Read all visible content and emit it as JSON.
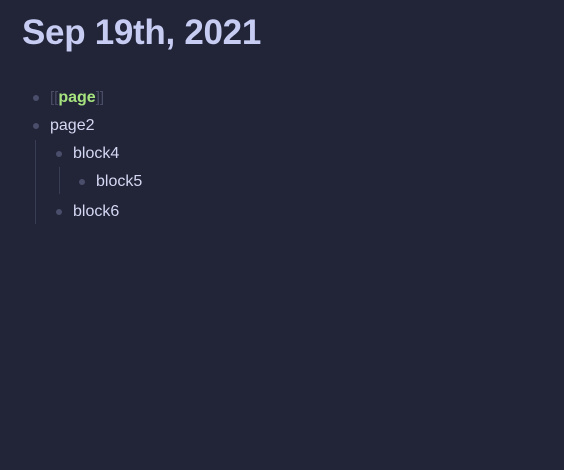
{
  "page": {
    "title": "Sep 19th, 2021"
  },
  "blocks": [
    {
      "open_bracket": "[[",
      "ref": "page",
      "close_bracket": "]]"
    },
    {
      "text": "page2",
      "children": [
        {
          "text": "block4",
          "children": [
            {
              "text": "block5"
            }
          ]
        },
        {
          "text": "block6"
        }
      ]
    }
  ],
  "colors": {
    "background": "#222438",
    "title": "#c7ccf3",
    "text": "#d5d8f3",
    "page_ref": "#a6e37f",
    "bullet": "#4b4e6b",
    "bracket": "#4a4d66"
  }
}
